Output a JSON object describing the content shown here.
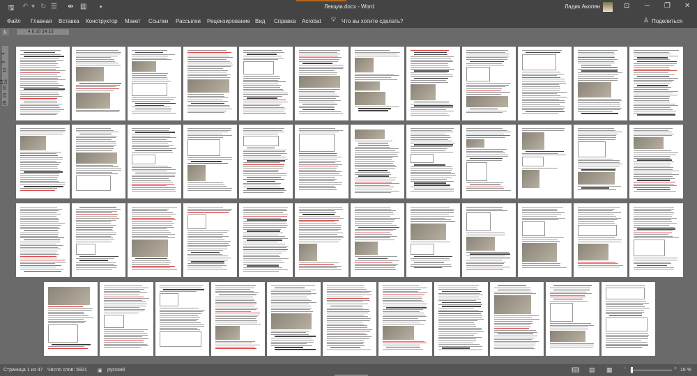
{
  "window": {
    "title": "Лекции.docx  -  Word",
    "user": "Ладик Акопян"
  },
  "quick_access": {
    "save": "save-icon",
    "undo": "undo-icon",
    "redo": "redo-icon",
    "more": "▾"
  },
  "ribbon_tabs": [
    "Файл",
    "Главная",
    "Вставка",
    "Конструктор",
    "Макет",
    "Ссылки",
    "Рассылки",
    "Рецензирование",
    "Вид",
    "Справка",
    "Acrobat"
  ],
  "tell_me": "Что вы хотите сделать?",
  "share": "Поделиться",
  "ruler": {
    "horizontal": "4  6   10   14 16",
    "tab_selector": "L",
    "vertical": [
      "4",
      "8",
      "10",
      "14 16",
      "20",
      "24",
      "28"
    ]
  },
  "document": {
    "page_count": 47,
    "rows": [
      12,
      12,
      12,
      11
    ]
  },
  "status": {
    "page": "Страница 1 из 47",
    "words": "Число слов: 5921",
    "language": "русский",
    "zoom": "16 %",
    "zoom_fraction": 0.16
  }
}
